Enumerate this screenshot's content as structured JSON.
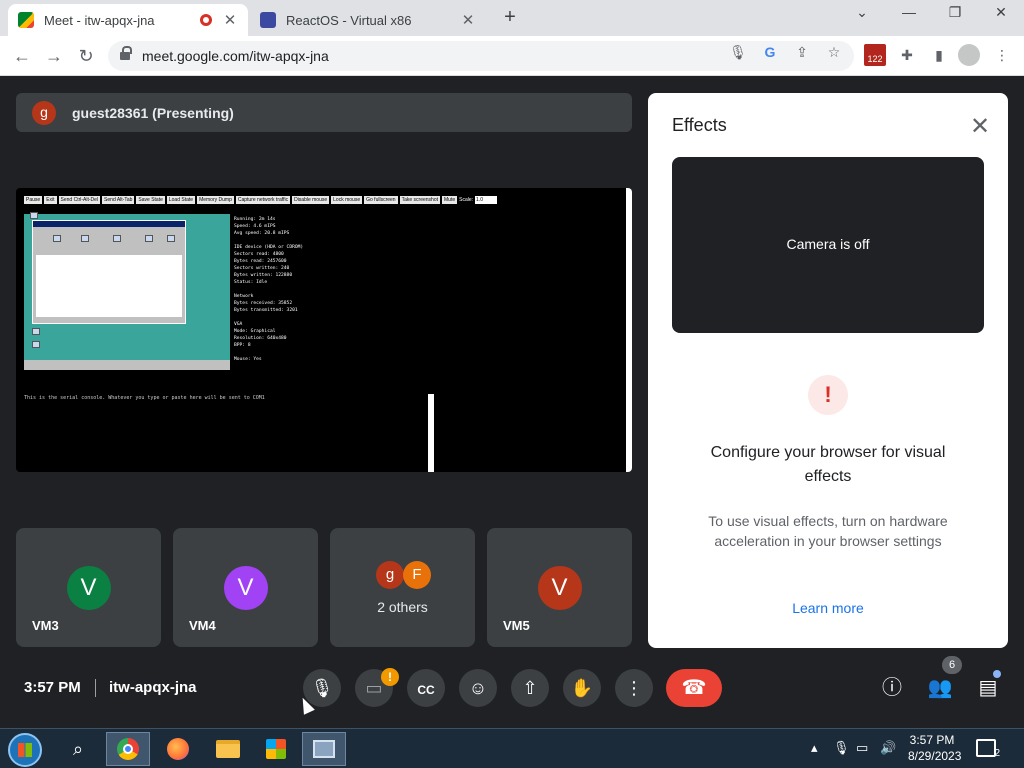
{
  "browser": {
    "tabs": [
      {
        "title": "Meet - itw-apqx-jna",
        "favicon": "google-meet-icon",
        "recording": true
      },
      {
        "title": "ReactOS - Virtual x86",
        "favicon": "reactos-icon"
      }
    ],
    "new_tab": "+",
    "window_controls": {
      "minimize": "—",
      "restore": "❐",
      "close": "✕",
      "tab_search": "⌄"
    },
    "url": "meet.google.com/itw-apqx-jna",
    "extension_badge": "122"
  },
  "stage": {
    "presenter_initial": "g",
    "presenter_title": "guest28361 (Presenting)",
    "emulator": {
      "toolbar": [
        "Pause",
        "Exit",
        "Send Ctrl-Alt-Del",
        "Send Alt-Tab",
        "Save State",
        "Load State",
        "Memory Dump",
        "Capture network traffic",
        "Disable mouse",
        "Lock mouse",
        "Go fullscreen",
        "Take screenshot",
        "Mute"
      ],
      "scale_label": "Scale:",
      "scale_value": "1.0",
      "stats": "Running: 2m 14s\nSpeed: 4.6 mIPS\nAvg speed: 20.8 mIPS\n\nIDE device (HDA or CDROM)\nSectors read: 4800\nBytes read: 2457600\nSectors written: 240\nBytes written: 122880\nStatus: Idle\n\nNetwork\nBytes received: 35852\nBytes transmitted: 3201\n\nVGA\nMode: Graphical\nResolution: 640x480\nBPP: 8\n\nMouse: Yes",
      "serial_text": "This is the serial console. Whatever you type or paste here will be sent to COM1"
    }
  },
  "tiles": [
    {
      "initial": "V",
      "name": "VM3",
      "color": "#0b8043"
    },
    {
      "initial": "V",
      "name": "VM4",
      "color": "#a142f4"
    },
    {
      "initials": [
        "g",
        "F"
      ],
      "colors": [
        "#b6361a",
        "#e8710a"
      ],
      "label": "2 others"
    },
    {
      "initial": "V",
      "name": "VM5",
      "color": "#b6361a"
    }
  ],
  "effects": {
    "title": "Effects",
    "camera_status": "Camera is off",
    "warning_icon": "!",
    "heading": "Configure your browser for visual effects",
    "body": "To use visual effects, turn on hardware acceleration in your browser settings",
    "link": "Learn more"
  },
  "controls": {
    "time": "3:57 PM",
    "meeting_code": "itw-apqx-jna",
    "camera_warning": "!",
    "participants_count": "6"
  },
  "taskbar": {
    "time": "3:57 PM",
    "date": "8/29/2023",
    "notifications": "2"
  },
  "colors": {
    "end_call": "#ea4335",
    "link": "#1a73e8",
    "panel_bg": "#202124"
  }
}
